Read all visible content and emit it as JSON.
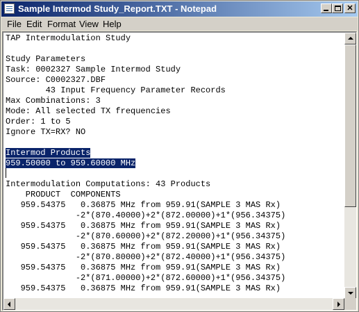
{
  "window": {
    "title": "Sample Intermod Study_Report.TXT - Notepad"
  },
  "menu": [
    "File",
    "Edit",
    "Format",
    "View",
    "Help"
  ],
  "document": {
    "lines": [
      "TAP Intermodulation Study",
      "",
      "Study Parameters",
      "Task: 0002327 Sample Intermod Study",
      "Source: C0002327.DBF",
      "        43 Input Frequency Parameter Records",
      "Max Combinations: 3",
      "Mode: All selected TX frequencies",
      "Order: 1 to 5",
      "Ignore TX=RX? NO",
      "",
      "Intermod Products",
      "959.50000 to 959.60000 MHz",
      "",
      "Intermodulation Computations: 43 Products",
      "    PRODUCT  COMPONENTS",
      "   959.54375   0.36875 MHz from 959.91(SAMPLE 3 MAS Rx)",
      "              -2*(870.40000)+2*(872.00000)+1*(956.34375)",
      "   959.54375   0.36875 MHz from 959.91(SAMPLE 3 MAS Rx)",
      "              -2*(870.60000)+2*(872.20000)+1*(956.34375)",
      "   959.54375   0.36875 MHz from 959.91(SAMPLE 3 MAS Rx)",
      "              -2*(870.80000)+2*(872.40000)+1*(956.34375)",
      "   959.54375   0.36875 MHz from 959.91(SAMPLE 3 MAS Rx)",
      "              -2*(871.00000)+2*(872.60000)+1*(956.34375)",
      "   959.54375   0.36875 MHz from 959.91(SAMPLE 3 MAS Rx)"
    ],
    "selected_lines": [
      11,
      12
    ]
  },
  "colors": {
    "selection": "#0a246a",
    "titlebar_start": "#0a246a",
    "titlebar_end": "#a6caf0"
  },
  "icons": [
    "notepad-app-icon",
    "minimize-icon",
    "maximize-icon",
    "close-icon",
    "scroll-up-arrow-icon",
    "scroll-down-arrow-icon",
    "scroll-left-arrow-icon",
    "scroll-right-arrow-icon"
  ]
}
